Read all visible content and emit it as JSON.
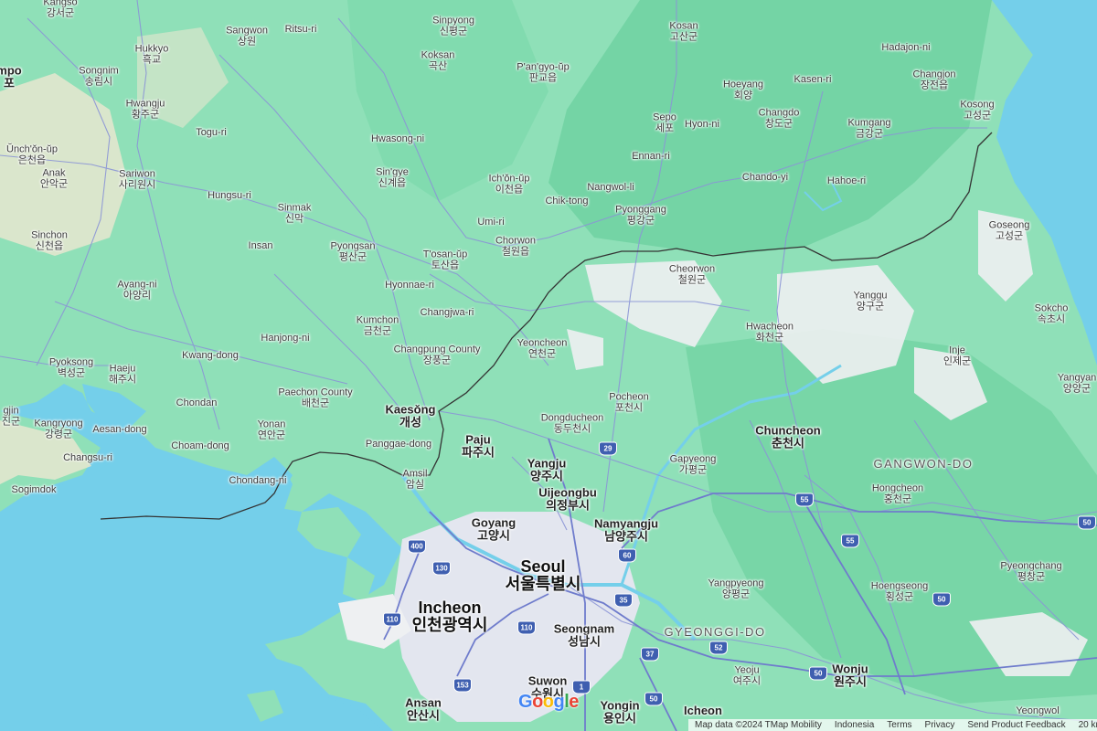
{
  "map": {
    "colors": {
      "water": "#74cfea",
      "land": "#8fe0b8",
      "forest": "#6dd1a0",
      "urban": "#eef0f2",
      "road": "#8b95d6",
      "border": "#333333"
    },
    "places": [
      {
        "id": "kangso",
        "en": "Kangso",
        "ko": "강서군"
      },
      {
        "id": "sangwon",
        "en": "Sangwon",
        "ko": "상원"
      },
      {
        "id": "ritsu",
        "en": "Ritsu-ri",
        "ko": ""
      },
      {
        "id": "sinpyong",
        "en": "Sinpyong",
        "ko": "신평군"
      },
      {
        "id": "kosan",
        "en": "Kosan",
        "ko": "고산군"
      },
      {
        "id": "hukkyo",
        "en": "Hukkyo",
        "ko": "흑교"
      },
      {
        "id": "songnim",
        "en": "Songnim",
        "ko": "송림시"
      },
      {
        "id": "koksan",
        "en": "Koksan",
        "ko": "곡산"
      },
      {
        "id": "pangyo",
        "en": "P'an'gyo-ŭp",
        "ko": "판교읍"
      },
      {
        "id": "hoeyang",
        "en": "Hoeyang",
        "ko": "회양"
      },
      {
        "id": "kasen",
        "en": "Kasen-ri",
        "ko": ""
      },
      {
        "id": "hadajon",
        "en": "Hadajon-ni",
        "ko": ""
      },
      {
        "id": "changjon",
        "en": "Changjon",
        "ko": "장전읍"
      },
      {
        "id": "kosong",
        "en": "Kosong",
        "ko": "고성군"
      },
      {
        "id": "hwangju",
        "en": "Hwangju",
        "ko": "황주군"
      },
      {
        "id": "sepo",
        "en": "Sepo",
        "ko": "세포"
      },
      {
        "id": "hyonni",
        "en": "Hyon-ni",
        "ko": ""
      },
      {
        "id": "changdo",
        "en": "Changdo",
        "ko": "창도군"
      },
      {
        "id": "kumgang",
        "en": "Kumgang",
        "ko": "금강군"
      },
      {
        "id": "togu",
        "en": "Togu-ri",
        "ko": ""
      },
      {
        "id": "hwasong",
        "en": "Hwasong-ni",
        "ko": ""
      },
      {
        "id": "unchon",
        "en": "Ŭnch'ŏn-ŭp",
        "ko": "은천읍"
      },
      {
        "id": "ennan",
        "en": "Ennan-ri",
        "ko": ""
      },
      {
        "id": "anak",
        "en": "Anak",
        "ko": "안악군"
      },
      {
        "id": "sariwon",
        "en": "Sariwon",
        "ko": "사리원시"
      },
      {
        "id": "singye",
        "en": "Sin'gye",
        "ko": "신계읍"
      },
      {
        "id": "ichon",
        "en": "Ich'ŏn-ŭp",
        "ko": "이천읍"
      },
      {
        "id": "chandoyi",
        "en": "Chando-yi",
        "ko": ""
      },
      {
        "id": "hahoe",
        "en": "Hahoe-ri",
        "ko": ""
      },
      {
        "id": "nangwol",
        "en": "Nangwol-li",
        "ko": ""
      },
      {
        "id": "hungsu",
        "en": "Hungsu-ri",
        "ko": ""
      },
      {
        "id": "chiktong",
        "en": "Chik-tong",
        "ko": ""
      },
      {
        "id": "sinmak",
        "en": "Sinmak",
        "ko": "신막"
      },
      {
        "id": "pyonggang",
        "en": "Pyonggang",
        "ko": "평강군"
      },
      {
        "id": "umi",
        "en": "Umi-ri",
        "ko": ""
      },
      {
        "id": "goseong",
        "en": "Goseong",
        "ko": "고성군"
      },
      {
        "id": "sinchon",
        "en": "Sinchon",
        "ko": "신천읍"
      },
      {
        "id": "insan",
        "en": "Insan",
        "ko": ""
      },
      {
        "id": "pyongsan",
        "en": "Pyongsan",
        "ko": "평산군"
      },
      {
        "id": "tosan",
        "en": "T'osan-ŭp",
        "ko": "토산읍"
      },
      {
        "id": "chorwon",
        "en": "Chorwon",
        "ko": "철원읍"
      },
      {
        "id": "cheorwon",
        "en": "Cheorwon",
        "ko": "철원군"
      },
      {
        "id": "ayang",
        "en": "Ayang-ni",
        "ko": "아양리"
      },
      {
        "id": "hyonnae",
        "en": "Hyonnae-ri",
        "ko": ""
      },
      {
        "id": "yanggu",
        "en": "Yanggu",
        "ko": "양구군"
      },
      {
        "id": "sokcho",
        "en": "Sokcho",
        "ko": "속초시"
      },
      {
        "id": "changjwa",
        "en": "Changjwa-ri",
        "ko": ""
      },
      {
        "id": "kumchon",
        "en": "Kumchon",
        "ko": "금천군"
      },
      {
        "id": "hwacheon",
        "en": "Hwacheon",
        "ko": "화천군"
      },
      {
        "id": "hanjong",
        "en": "Hanjong-ni",
        "ko": ""
      },
      {
        "id": "yeoncheon",
        "en": "Yeoncheon",
        "ko": "연천군"
      },
      {
        "id": "changpung",
        "en": "Changpung County",
        "ko": "장풍군"
      },
      {
        "id": "inje",
        "en": "Inje",
        "ko": "인제군"
      },
      {
        "id": "kwangdong",
        "en": "Kwang-dong",
        "ko": ""
      },
      {
        "id": "pyoksong",
        "en": "Pyoksong",
        "ko": "벽성군"
      },
      {
        "id": "haeju",
        "en": "Haeju",
        "ko": "해주시"
      },
      {
        "id": "yangyang",
        "en": "Yangyan",
        "ko": "양양군"
      },
      {
        "id": "paechon",
        "en": "Paechon County",
        "ko": "배천군"
      },
      {
        "id": "pocheon",
        "en": "Pocheon",
        "ko": "포천시"
      },
      {
        "id": "chondan",
        "en": "Chondan",
        "ko": ""
      },
      {
        "id": "kaesong",
        "en": "Kaesŏng",
        "ko": "개성"
      },
      {
        "id": "dongducheon",
        "en": "Dongducheon",
        "ko": "동두천시"
      },
      {
        "id": "chuncheon",
        "en": "Chuncheon",
        "ko": "춘천시"
      },
      {
        "id": "ongjin",
        "en": "gjin",
        "ko": "진군"
      },
      {
        "id": "kangryong",
        "en": "Kangryong",
        "ko": "강령군"
      },
      {
        "id": "aesan",
        "en": "Aesan-dong",
        "ko": ""
      },
      {
        "id": "yonan",
        "en": "Yonan",
        "ko": "연안군"
      },
      {
        "id": "paju",
        "en": "Paju",
        "ko": "파주시"
      },
      {
        "id": "panggae",
        "en": "Panggae-dong",
        "ko": ""
      },
      {
        "id": "choam",
        "en": "Choam-dong",
        "ko": ""
      },
      {
        "id": "changsu",
        "en": "Changsu-ri",
        "ko": ""
      },
      {
        "id": "yangju",
        "en": "Yangju",
        "ko": "양주시"
      },
      {
        "id": "gapyeong",
        "en": "Gapyeong",
        "ko": "가평군"
      },
      {
        "id": "amsil",
        "en": "Amsil",
        "ko": "암실"
      },
      {
        "id": "chondang",
        "en": "Chondang-ni",
        "ko": ""
      },
      {
        "id": "sogimdok",
        "en": "Sogimdok",
        "ko": ""
      },
      {
        "id": "uijeongbu",
        "en": "Uijeongbu",
        "ko": "의정부시"
      },
      {
        "id": "hongcheon",
        "en": "Hongcheon",
        "ko": "홍천군"
      },
      {
        "id": "goyang",
        "en": "Goyang",
        "ko": "고양시"
      },
      {
        "id": "namyangju",
        "en": "Namyangju",
        "ko": "남양주시"
      },
      {
        "id": "seoul",
        "en": "Seoul",
        "ko": "서울특별시"
      },
      {
        "id": "pyeongchang",
        "en": "Pyeongchang",
        "ko": "평창군"
      },
      {
        "id": "yangpyeong",
        "en": "Yangpyeong",
        "ko": "양평군"
      },
      {
        "id": "hoengseong",
        "en": "Hoengseong",
        "ko": "횡성군"
      },
      {
        "id": "incheon",
        "en": "Incheon",
        "ko": "인천광역시"
      },
      {
        "id": "seongnam",
        "en": "Seongnam",
        "ko": "성남시"
      },
      {
        "id": "wonju",
        "en": "Wonju",
        "ko": "원주시"
      },
      {
        "id": "yeoju",
        "en": "Yeoju",
        "ko": "여주시"
      },
      {
        "id": "suwon",
        "en": "Suwon",
        "ko": "수원시"
      },
      {
        "id": "ansan",
        "en": "Ansan",
        "ko": "안산시"
      },
      {
        "id": "yongin",
        "en": "Yongin",
        "ko": "용인시"
      },
      {
        "id": "icheon",
        "en": "Icheon",
        "ko": ""
      },
      {
        "id": "yeongwol",
        "en": "Yeongwol",
        "ko": ""
      },
      {
        "id": "pohang",
        "en": "mpo",
        "ko": "포"
      }
    ],
    "regions": [
      {
        "id": "gangwon",
        "text": "GANGWON-DO"
      },
      {
        "id": "gyeonggi",
        "text": "GYEONGGI-DO"
      }
    ],
    "shields": [
      {
        "id": "r400",
        "num": "400",
        "color": "#3f5fb0"
      },
      {
        "id": "r130",
        "num": "130",
        "color": "#3f5fb0"
      },
      {
        "id": "r110a",
        "num": "110",
        "color": "#3f5fb0"
      },
      {
        "id": "r110b",
        "num": "110",
        "color": "#3f5fb0"
      },
      {
        "id": "r153",
        "num": "153",
        "color": "#3f5fb0"
      },
      {
        "id": "r29",
        "num": "29",
        "color": "#3f5fb0"
      },
      {
        "id": "r60",
        "num": "60",
        "color": "#3f5fb0"
      },
      {
        "id": "r35",
        "num": "35",
        "color": "#3f5fb0"
      },
      {
        "id": "r55a",
        "num": "55",
        "color": "#3f5fb0"
      },
      {
        "id": "r55b",
        "num": "55",
        "color": "#3f5fb0"
      },
      {
        "id": "r52",
        "num": "52",
        "color": "#3f5fb0"
      },
      {
        "id": "r37",
        "num": "37",
        "color": "#3f5fb0"
      },
      {
        "id": "r50a",
        "num": "50",
        "color": "#3f5fb0"
      },
      {
        "id": "r50b",
        "num": "50",
        "color": "#3f5fb0"
      },
      {
        "id": "r50c",
        "num": "50",
        "color": "#3f5fb0"
      },
      {
        "id": "r50d",
        "num": "50",
        "color": "#3f5fb0"
      },
      {
        "id": "r1",
        "num": "1",
        "color": "#3f5fb0"
      }
    ],
    "logo": {
      "letters": [
        {
          "ch": "G",
          "color": "#4285f4"
        },
        {
          "ch": "o",
          "color": "#ea4335"
        },
        {
          "ch": "o",
          "color": "#fbbc05"
        },
        {
          "ch": "g",
          "color": "#4285f4"
        },
        {
          "ch": "l",
          "color": "#34a853"
        },
        {
          "ch": "e",
          "color": "#ea4335"
        }
      ]
    },
    "attribution": {
      "map_data": "Map data ©2024 TMap Mobility",
      "country": "Indonesia",
      "terms": "Terms",
      "privacy": "Privacy",
      "feedback": "Send Product Feedback",
      "scale": "20 km"
    }
  }
}
